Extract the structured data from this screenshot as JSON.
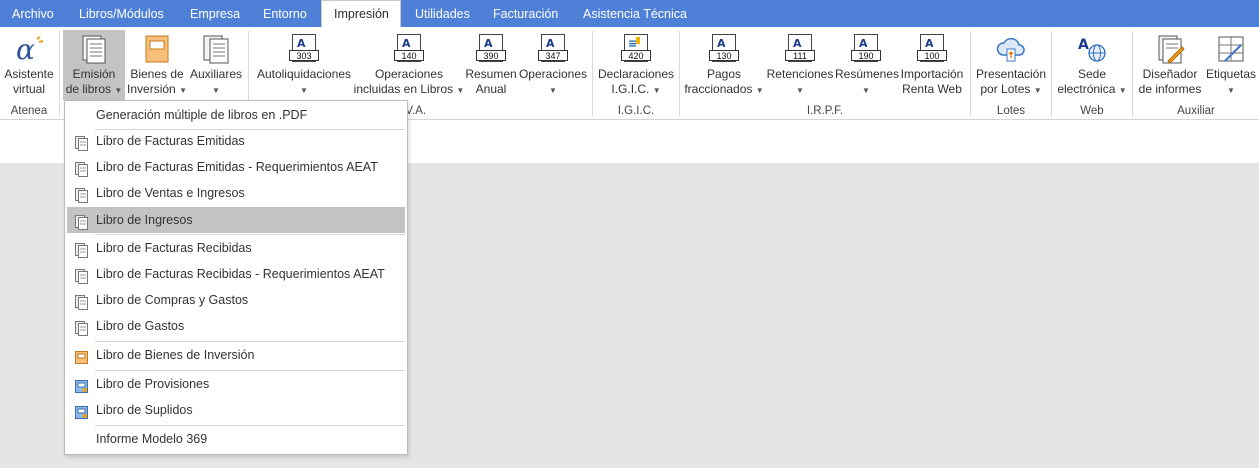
{
  "menubar": {
    "tabs": [
      {
        "label": "Archivo"
      },
      {
        "label": "Libros/Módulos"
      },
      {
        "label": "Empresa"
      },
      {
        "label": "Entorno"
      },
      {
        "label": "Impresión",
        "active": true
      },
      {
        "label": "Utilidades"
      },
      {
        "label": "Facturación"
      },
      {
        "label": "Asistencia Técnica"
      }
    ]
  },
  "ribbon": {
    "groups": {
      "atenea": "Atenea",
      "iva": "I.V.A.",
      "igic": "I.G.I.C.",
      "irpf": "I.R.P.F.",
      "lotes": "Lotes",
      "web": "Web",
      "auxiliar": "Auxiliar"
    },
    "buttons": {
      "asistente": {
        "line1": "Asistente",
        "line2": "virtual",
        "icon": "alpha-icon"
      },
      "emision": {
        "line1": "Emisión",
        "line2": "de libros",
        "icon": "books-icon"
      },
      "bienes": {
        "line1": "Bienes de",
        "line2": "Inversión",
        "icon": "orange-book-icon"
      },
      "auxiliares": {
        "line1": "Auxiliares",
        "line2": "",
        "icon": "documents-icon"
      },
      "autoliquidaciones": {
        "line1": "Autoliquidaciones",
        "line2": "",
        "form": "303"
      },
      "operaciones_libros": {
        "line1": "Operaciones",
        "line2": "incluidas en Libros",
        "form": "140"
      },
      "resumen_anual": {
        "line1": "Resumen",
        "line2": "Anual",
        "form": "390"
      },
      "operaciones": {
        "line1": "Operaciones",
        "line2": "",
        "form": "347"
      },
      "declaraciones": {
        "line1": "Declaraciones",
        "line2": "I.G.I.C.",
        "form": "420"
      },
      "pagos": {
        "line1": "Pagos",
        "line2": "fraccionados",
        "form": "130"
      },
      "retenciones": {
        "line1": "Retenciones",
        "line2": "",
        "form": "111"
      },
      "resumenes": {
        "line1": "Resúmenes",
        "line2": "",
        "form": "190"
      },
      "importacion": {
        "line1": "Importación",
        "line2": "Renta Web",
        "form": "100"
      },
      "presentacion": {
        "line1": "Presentación",
        "line2": "por Lotes",
        "icon": "cloud-upload-icon"
      },
      "sede": {
        "line1": "Sede",
        "line2": "electrónica",
        "icon": "globe-icon"
      },
      "disenador": {
        "line1": "Diseñador",
        "line2": "de informes",
        "icon": "report-designer-icon"
      },
      "etiquetas": {
        "line1": "Etiquetas",
        "line2": "",
        "icon": "labels-icon"
      }
    }
  },
  "dropdown": {
    "items": [
      {
        "label": "Generación múltiple de libros en .PDF",
        "icon": "none"
      },
      {
        "label": "Libro de Facturas Emitidas",
        "icon": "ledger-icon"
      },
      {
        "label": "Libro de Facturas Emitidas - Requerimientos AEAT",
        "icon": "ledger-icon"
      },
      {
        "label": "Libro de Ventas e Ingresos",
        "icon": "ledger-icon"
      },
      {
        "label": "Libro de Ingresos",
        "icon": "ledger-icon",
        "highlighted": true
      },
      {
        "label": "Libro de Facturas Recibidas",
        "icon": "ledger-icon"
      },
      {
        "label": "Libro de Facturas Recibidas - Requerimientos AEAT",
        "icon": "ledger-icon"
      },
      {
        "label": "Libro de Compras y Gastos",
        "icon": "ledger-icon"
      },
      {
        "label": "Libro de Gastos",
        "icon": "ledger-icon"
      },
      {
        "label": "Libro de Bienes de Inversión",
        "icon": "orange-ledger-icon"
      },
      {
        "label": "Libro de Provisiones",
        "icon": "blue-ledger-icon"
      },
      {
        "label": "Libro de Suplidos",
        "icon": "blue-ledger-icon"
      },
      {
        "label": "Informe Modelo 369",
        "icon": "none"
      }
    ]
  },
  "colors": {
    "menubar": "#4f80d8",
    "pressed": "#c3c3c3",
    "workspace": "#e5e5e5",
    "aeat_blue": "#1a3a8c"
  }
}
